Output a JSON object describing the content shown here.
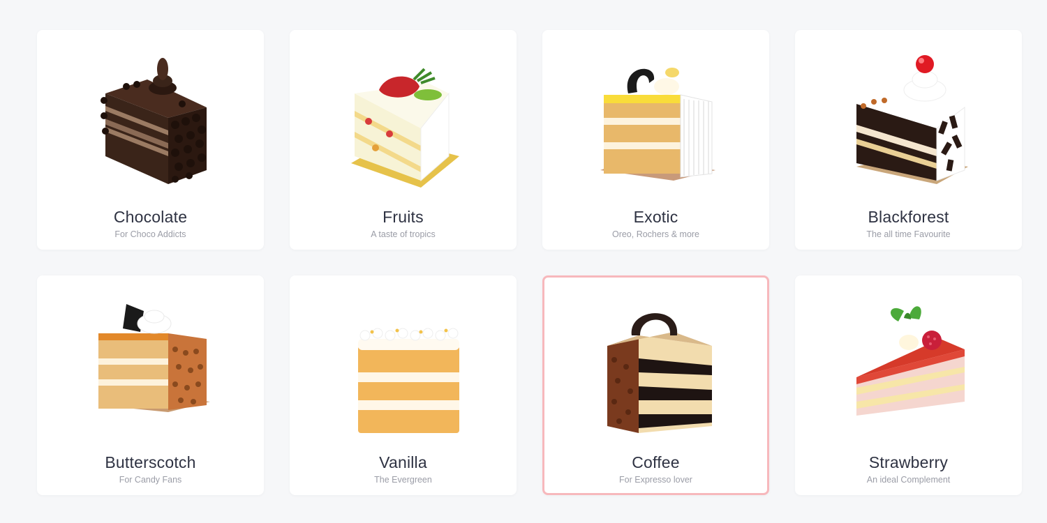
{
  "categories": [
    {
      "title": "Chocolate",
      "subtitle": "For Choco Addicts",
      "icon": "chocolate-cake-slice-icon"
    },
    {
      "title": "Fruits",
      "subtitle": "A taste of tropics",
      "icon": "fruit-cake-slice-icon"
    },
    {
      "title": "Exotic",
      "subtitle": "Oreo, Rochers & more",
      "icon": "exotic-cake-slice-icon"
    },
    {
      "title": "Blackforest",
      "subtitle": "The all time Favourite",
      "icon": "blackforest-cake-slice-icon"
    },
    {
      "title": "Butterscotch",
      "subtitle": "For Candy Fans",
      "icon": "butterscotch-cake-slice-icon"
    },
    {
      "title": "Vanilla",
      "subtitle": "The Evergreen",
      "icon": "vanilla-cake-slice-icon"
    },
    {
      "title": "Coffee",
      "subtitle": "For Expresso lover",
      "icon": "coffee-cake-slice-icon",
      "selected": true
    },
    {
      "title": "Strawberry",
      "subtitle": "An ideal Complement",
      "icon": "strawberry-cake-slice-icon"
    }
  ],
  "colors": {
    "background": "#f6f7f9",
    "card": "#ffffff",
    "selected_border": "#f7b8bc",
    "title": "#2e3242",
    "subtitle": "#9a9ca6"
  }
}
